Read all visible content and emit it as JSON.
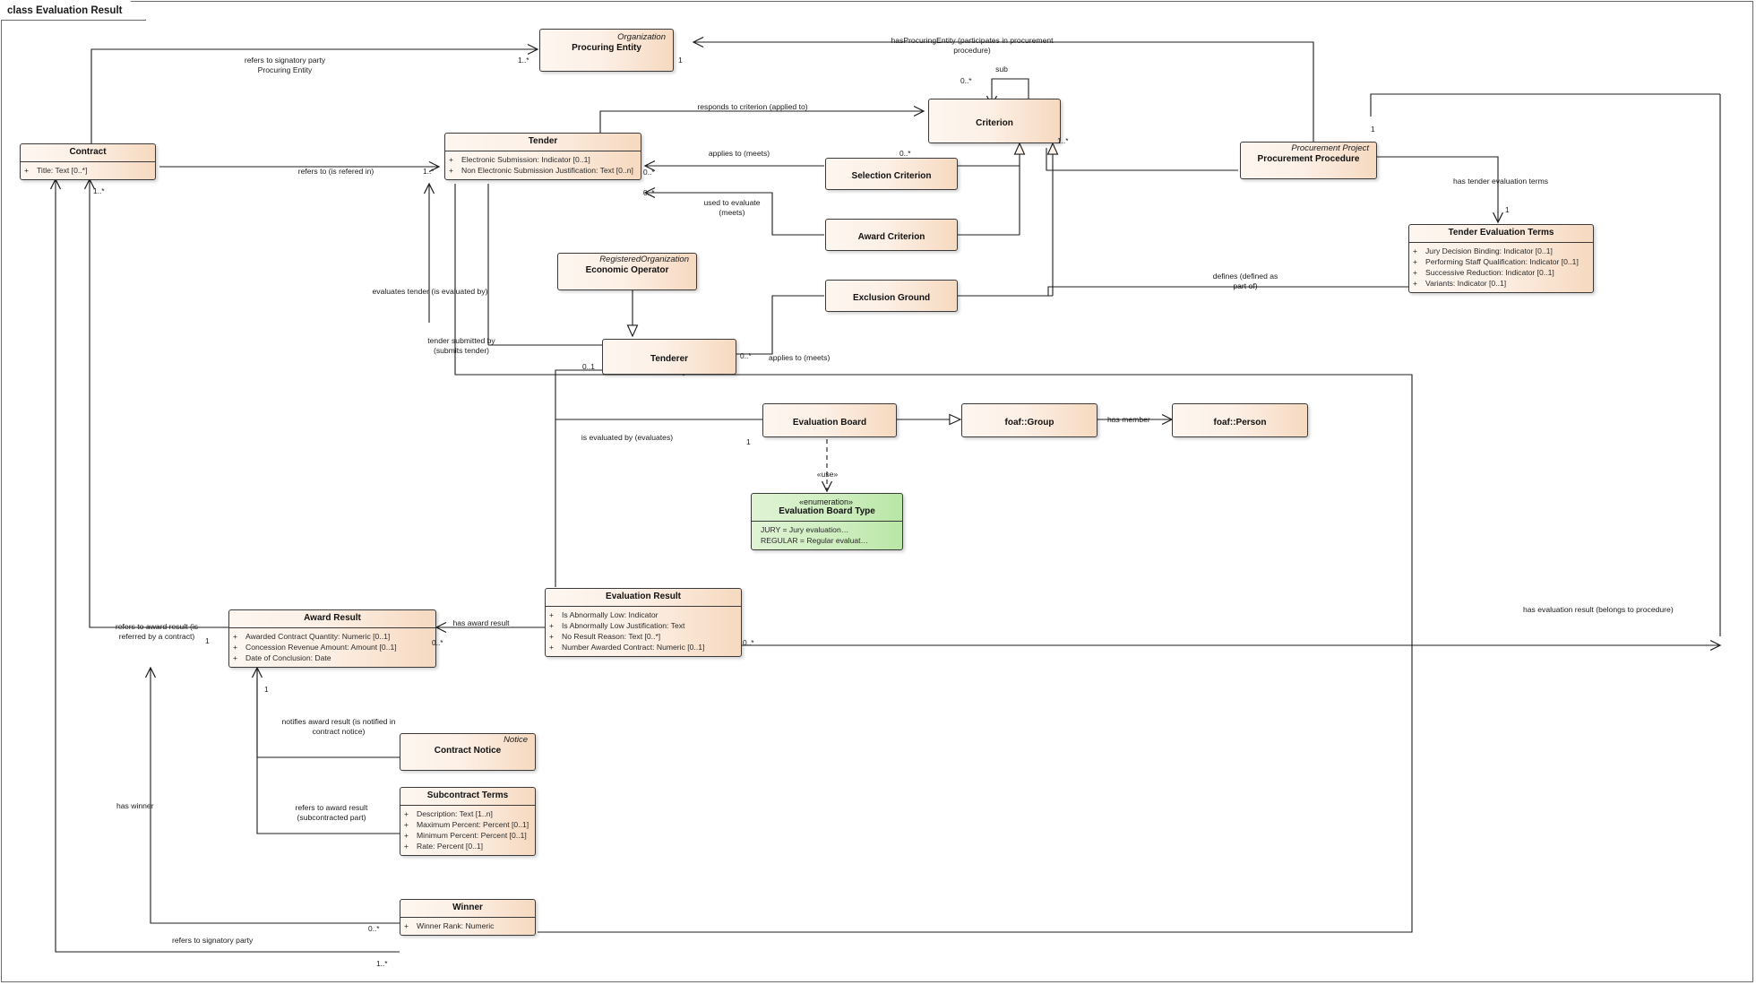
{
  "diagram": {
    "tab_label": "class Evaluation Result",
    "colors": {
      "class_fill_light": "#fdf6f0",
      "class_fill_dark": "#f6d9c0",
      "enum_fill_light": "#dff3d4",
      "enum_fill_dark": "#b9e6a6",
      "line": "#1c1c1c",
      "border": "#3a3a3a"
    }
  },
  "classes": [
    {
      "id": "contract",
      "name": "Contract",
      "stereotype": "",
      "attributes": [
        "Title: Text [0..*]"
      ]
    },
    {
      "id": "procuring_entity",
      "name": "Procuring Entity",
      "stereotype": "Organization",
      "attributes": []
    },
    {
      "id": "tender",
      "name": "Tender",
      "stereotype": "",
      "attributes": [
        "Electronic Submission: Indicator [0..1]",
        "Non Electronic Submission Justification: Text [0..n]"
      ]
    },
    {
      "id": "criterion",
      "name": "Criterion",
      "stereotype": "",
      "attributes": []
    },
    {
      "id": "selection_criterion",
      "name": "Selection Criterion",
      "stereotype": "",
      "attributes": []
    },
    {
      "id": "award_criterion",
      "name": "Award Criterion",
      "stereotype": "",
      "attributes": []
    },
    {
      "id": "exclusion_ground",
      "name": "Exclusion Ground",
      "stereotype": "",
      "attributes": []
    },
    {
      "id": "procurement_procedure",
      "name": "Procurement Procedure",
      "stereotype": "Procurement Project",
      "attributes": []
    },
    {
      "id": "tender_evaluation_terms",
      "name": "Tender Evaluation Terms",
      "stereotype": "",
      "attributes": [
        "Jury Decision Binding: Indicator [0..1]",
        "Performing Staff Qualification: Indicator [0..1]",
        "Successive Reduction: Indicator [0..1]",
        "Variants: Indicator [0..1]"
      ]
    },
    {
      "id": "economic_operator",
      "name": "Economic Operator",
      "stereotype": "RegisteredOrganization",
      "attributes": []
    },
    {
      "id": "tenderer",
      "name": "Tenderer",
      "stereotype": "",
      "attributes": []
    },
    {
      "id": "evaluation_board",
      "name": "Evaluation Board",
      "stereotype": "",
      "attributes": []
    },
    {
      "id": "foaf_group",
      "name": "foaf::Group",
      "stereotype": "",
      "attributes": []
    },
    {
      "id": "foaf_person",
      "name": "foaf::Person",
      "stereotype": "",
      "attributes": []
    },
    {
      "id": "evaluation_board_type",
      "name": "Evaluation Board Type",
      "stereotype": "«enumeration»",
      "attributes": [
        "JURY = Jury evaluation…",
        "REGULAR = Regular evaluat…"
      ]
    },
    {
      "id": "evaluation_result",
      "name": "Evaluation Result",
      "stereotype": "",
      "attributes": [
        "Is Abnormally Low: Indicator",
        "Is Abnormally Low Justification: Text",
        "No Result Reason: Text [0..*]",
        "Number Awarded Contract: Numeric [0..1]"
      ]
    },
    {
      "id": "award_result",
      "name": "Award Result",
      "stereotype": "",
      "attributes": [
        "Awarded Contract Quantity: Numeric [0..1]",
        "Concession Revenue Amount: Amount [0..1]",
        "Date of Conclusion: Date"
      ]
    },
    {
      "id": "contract_notice",
      "name": "Contract Notice",
      "stereotype": "Notice",
      "attributes": []
    },
    {
      "id": "subcontract_terms",
      "name": "Subcontract Terms",
      "stereotype": "",
      "attributes": [
        "Description: Text [1..n]",
        "Maximum Percent: Percent [0..1]",
        "Minimum Percent: Percent [0..1]",
        "Rate: Percent [0..1]"
      ]
    },
    {
      "id": "winner",
      "name": "Winner",
      "stereotype": "",
      "attributes": [
        "Winner Rank: Numeric"
      ]
    }
  ],
  "connector_labels": {
    "refers_signatory_pe": "refers to signatory party\nProcuring Entity",
    "has_procuring_entity": "hasProcuringEntity (participates in procurement\nprocedure)",
    "sub": "sub",
    "responds_to_criterion": "responds to criterion (applied to)",
    "applies_to_meets_tender": "applies to (meets)",
    "used_to_evaluate": "used to evaluate\n(meets)",
    "refers_to_is_refered_in": "refers to (is refered in)",
    "has_tender_evaluation_terms": "has tender evaluation terms",
    "defines_part_of": "defines (defined as\npart of)",
    "evaluates_tender": "evaluates tender (is evaluated by)",
    "tender_submitted_by": "tender submitted by\n(submits tender)",
    "applies_to_meets_tenderer": "applies to (meets)",
    "is_evaluated_by_evaluates": "is evaluated by (evaluates)",
    "has_member": "has member",
    "use": "«use»",
    "has_award_result": "has award result",
    "refers_to_award_result_contract": "refers to award result (is\nreferred by a contract)",
    "has_evaluation_result": "has evaluation result (belongs to procedure)",
    "notifies_award_result": "notifies award result (is notified in\ncontract notice)",
    "refers_to_award_result_sub": "refers to award result\n(subcontracted part)",
    "has_winner": "has winner",
    "refers_signatory_winner": "refers to signatory party"
  },
  "multiplicities": {
    "pe_left": "1..*",
    "pe_right": "1",
    "criterion_sub": "0..*",
    "criterion_left": "0..*",
    "criterion_sub_generalization": "1..*",
    "tender_left": "1..*",
    "tender_right_top": "0..*",
    "tender_right_bottom": "0..*",
    "contract_bottom": "1..*",
    "proc_proj_top": "1",
    "tet_top": "1",
    "tenderer_left": "0..1",
    "tenderer_right": "0..*",
    "evaluation_board_left": "1",
    "evaluation_result_left": "0..*",
    "evaluation_result_right": "0..*",
    "award_result_left": "1",
    "award_result_bottom": "1",
    "winner_top": "0..*",
    "winner_bottom": "1..*"
  }
}
